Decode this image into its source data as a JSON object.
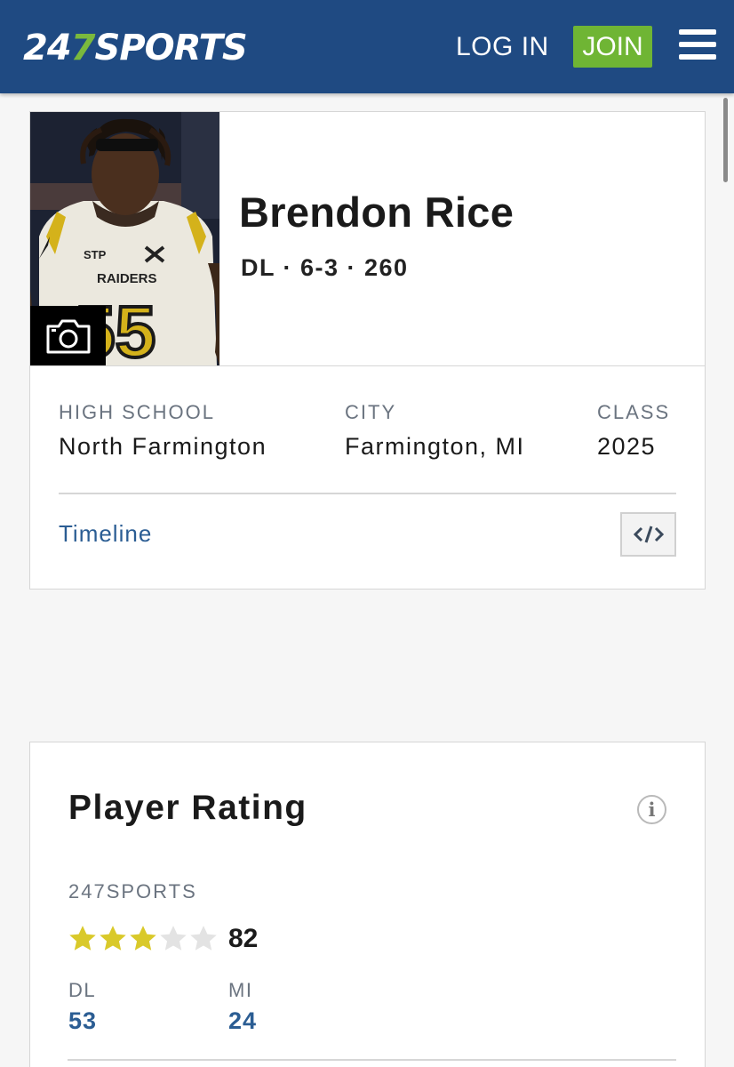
{
  "header": {
    "logo": {
      "part1": "24",
      "part2": "7",
      "part3": "SPORTS"
    },
    "login_label": "LOG IN",
    "join_label": "JOIN",
    "colors": {
      "bar": "#1f4a82",
      "join": "#6fb534",
      "logo_accent": "#7ab93d"
    }
  },
  "player": {
    "name": "Brendon Rice",
    "meta": "DL · 6-3 · 260",
    "photo_icon": "camera-icon",
    "info": [
      {
        "label": "HIGH SCHOOL",
        "value": "North Farmington"
      },
      {
        "label": "CITY",
        "value": "Farmington, MI"
      },
      {
        "label": "CLASS",
        "value": "2025"
      }
    ],
    "timeline_label": "Timeline",
    "embed_icon": "code-icon"
  },
  "rating": {
    "title": "Player Rating",
    "info_glyph": "i",
    "source": "247SPORTS",
    "stars": 3,
    "stars_max": 5,
    "score": "82",
    "ranks": [
      {
        "label": "DL",
        "value": "53"
      },
      {
        "label": "MI",
        "value": "24"
      }
    ]
  }
}
